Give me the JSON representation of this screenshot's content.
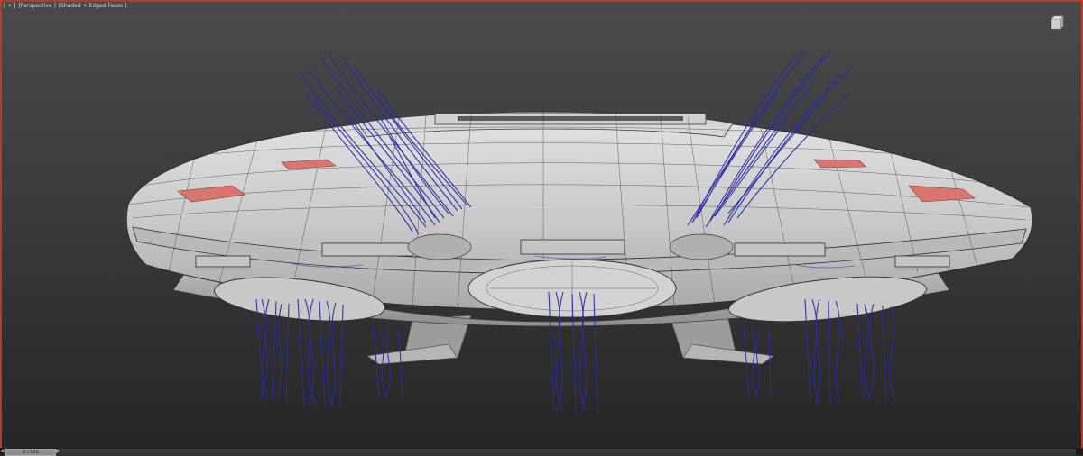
{
  "viewport": {
    "label_menu": "[ + ]",
    "label_view": "[Perspective ]",
    "label_shading": "[Shaded + Edged Faces ]",
    "border_color": "#b83a2a"
  },
  "icons": {
    "viewcube": "viewcube-icon",
    "prev_frame": "left-arrow-icon",
    "next_frame": "right-arrow-icon"
  },
  "timeline": {
    "frame_display": "0 / 100"
  },
  "colors": {
    "hull": "#cfcfcf",
    "wire": "#2a2a2a",
    "lights": "#d9756e",
    "hair": "#2a2aa8"
  }
}
